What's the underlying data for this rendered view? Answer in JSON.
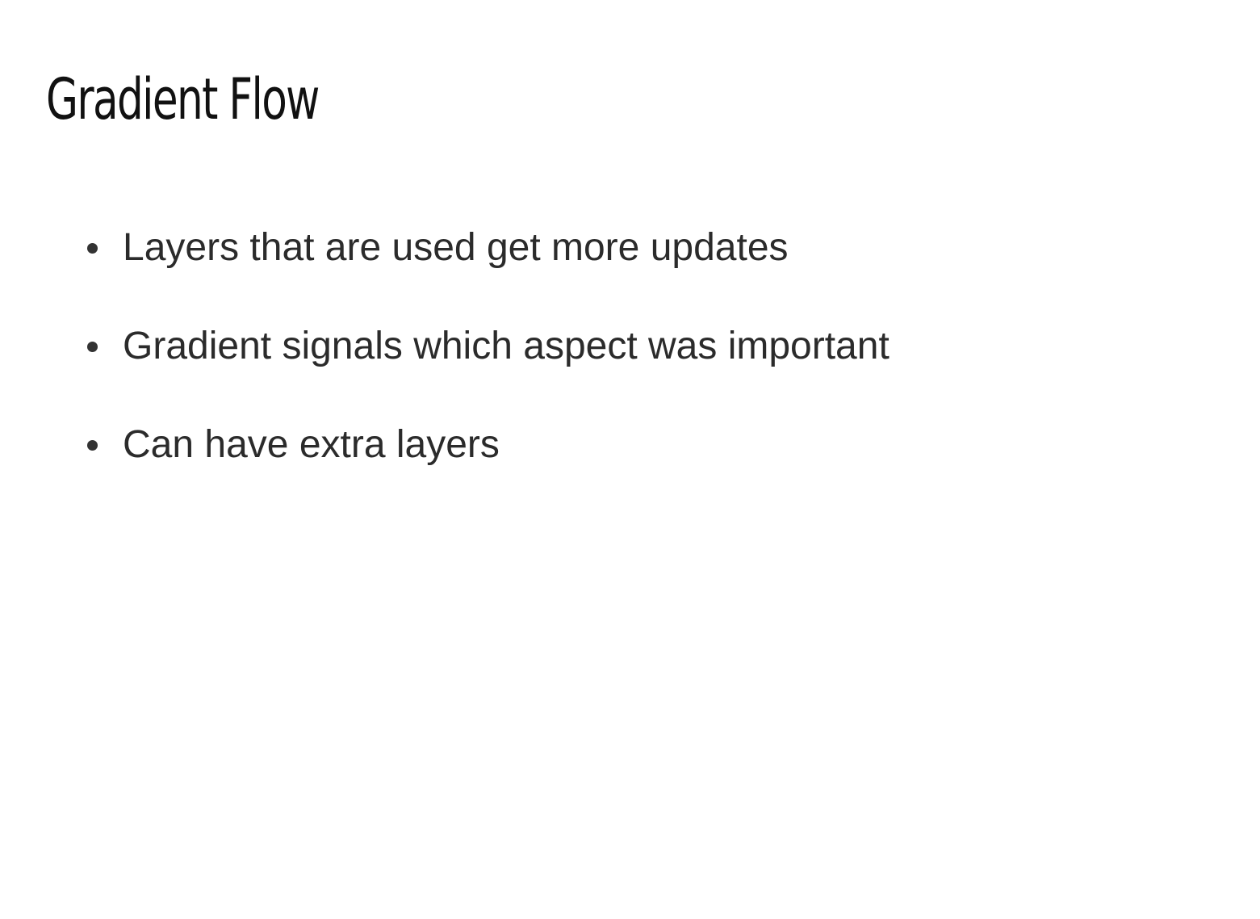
{
  "slide": {
    "title": "Gradient Flow",
    "bullets": [
      "Layers that are used get more updates",
      "Gradient signals which aspect was important",
      "Can have extra layers"
    ]
  }
}
